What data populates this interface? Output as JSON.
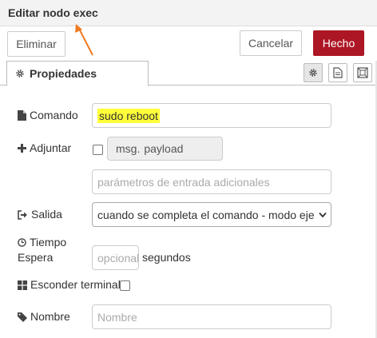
{
  "header": {
    "title": "Editar nodo exec"
  },
  "buttons": {
    "delete": "Eliminar",
    "cancel": "Cancelar",
    "done": "Hecho"
  },
  "tabs": [
    {
      "label": "Propiedades",
      "icon": "gear-icon",
      "selected": true
    }
  ],
  "toolbar_icons": [
    "gear-icon",
    "document-icon",
    "frame-icon"
  ],
  "form": {
    "command": {
      "label": "Comando",
      "value": "sudo reboot",
      "highlighted": true
    },
    "append": {
      "label": "Adjuntar",
      "checked": false,
      "type_prefix": "msg.",
      "value": "payload",
      "extra_placeholder": "parámetros de entrada adicionales"
    },
    "output": {
      "label": "Salida",
      "selected": "cuando se completa el comando - modo ejecución"
    },
    "timeout": {
      "label_line1": "Tiempo",
      "label_line2": "Espera",
      "placeholder": "opcional",
      "suffix": "segundos"
    },
    "hide_terminal": {
      "label": "Esconder terminal",
      "checked": false
    },
    "name": {
      "label": "Nombre",
      "placeholder": "Nombre"
    }
  },
  "colors": {
    "accent": "#ad1625",
    "highlight": "#ffff3a",
    "annotation": "#f07a20"
  }
}
